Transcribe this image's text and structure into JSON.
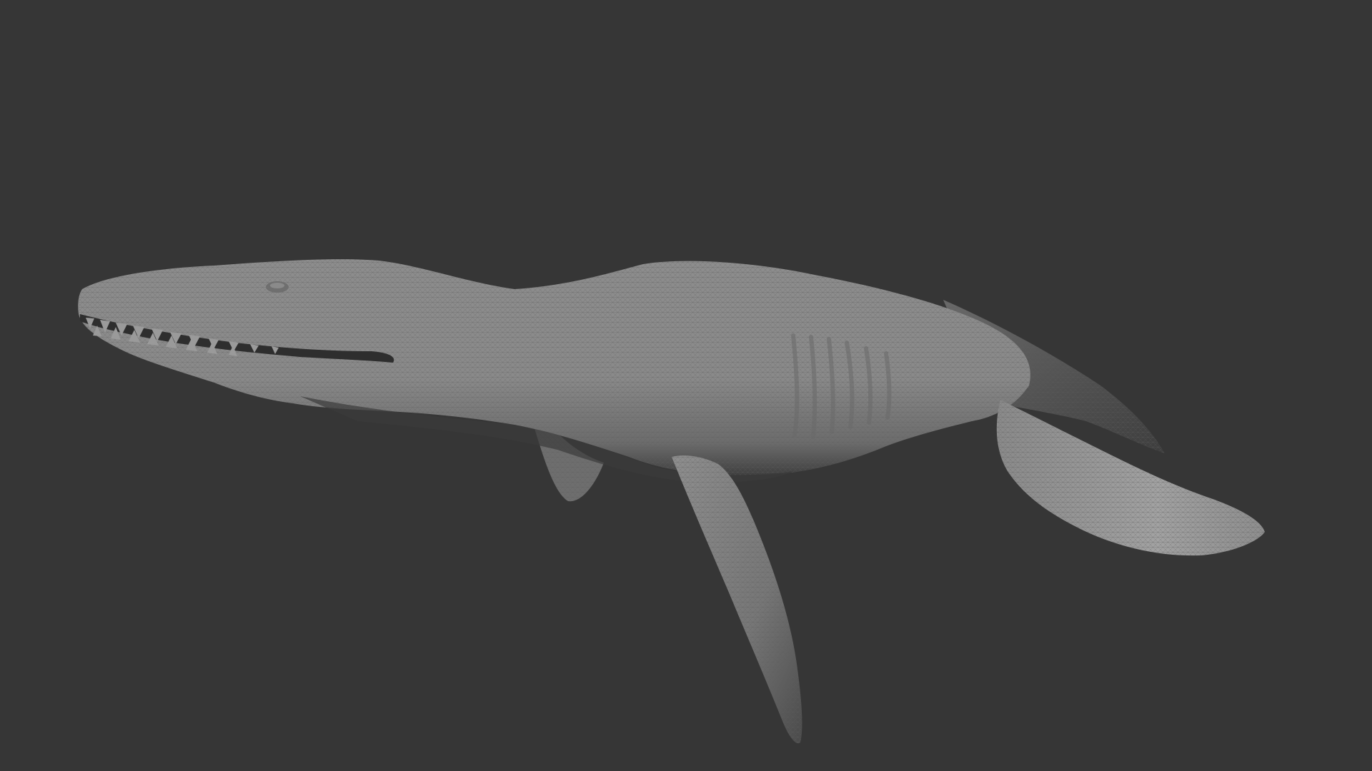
{
  "viewport": {
    "background_color": "#363636",
    "subject": "render",
    "model_color": "#8c8c8c",
    "shadow_color": "#4a4a4a"
  }
}
